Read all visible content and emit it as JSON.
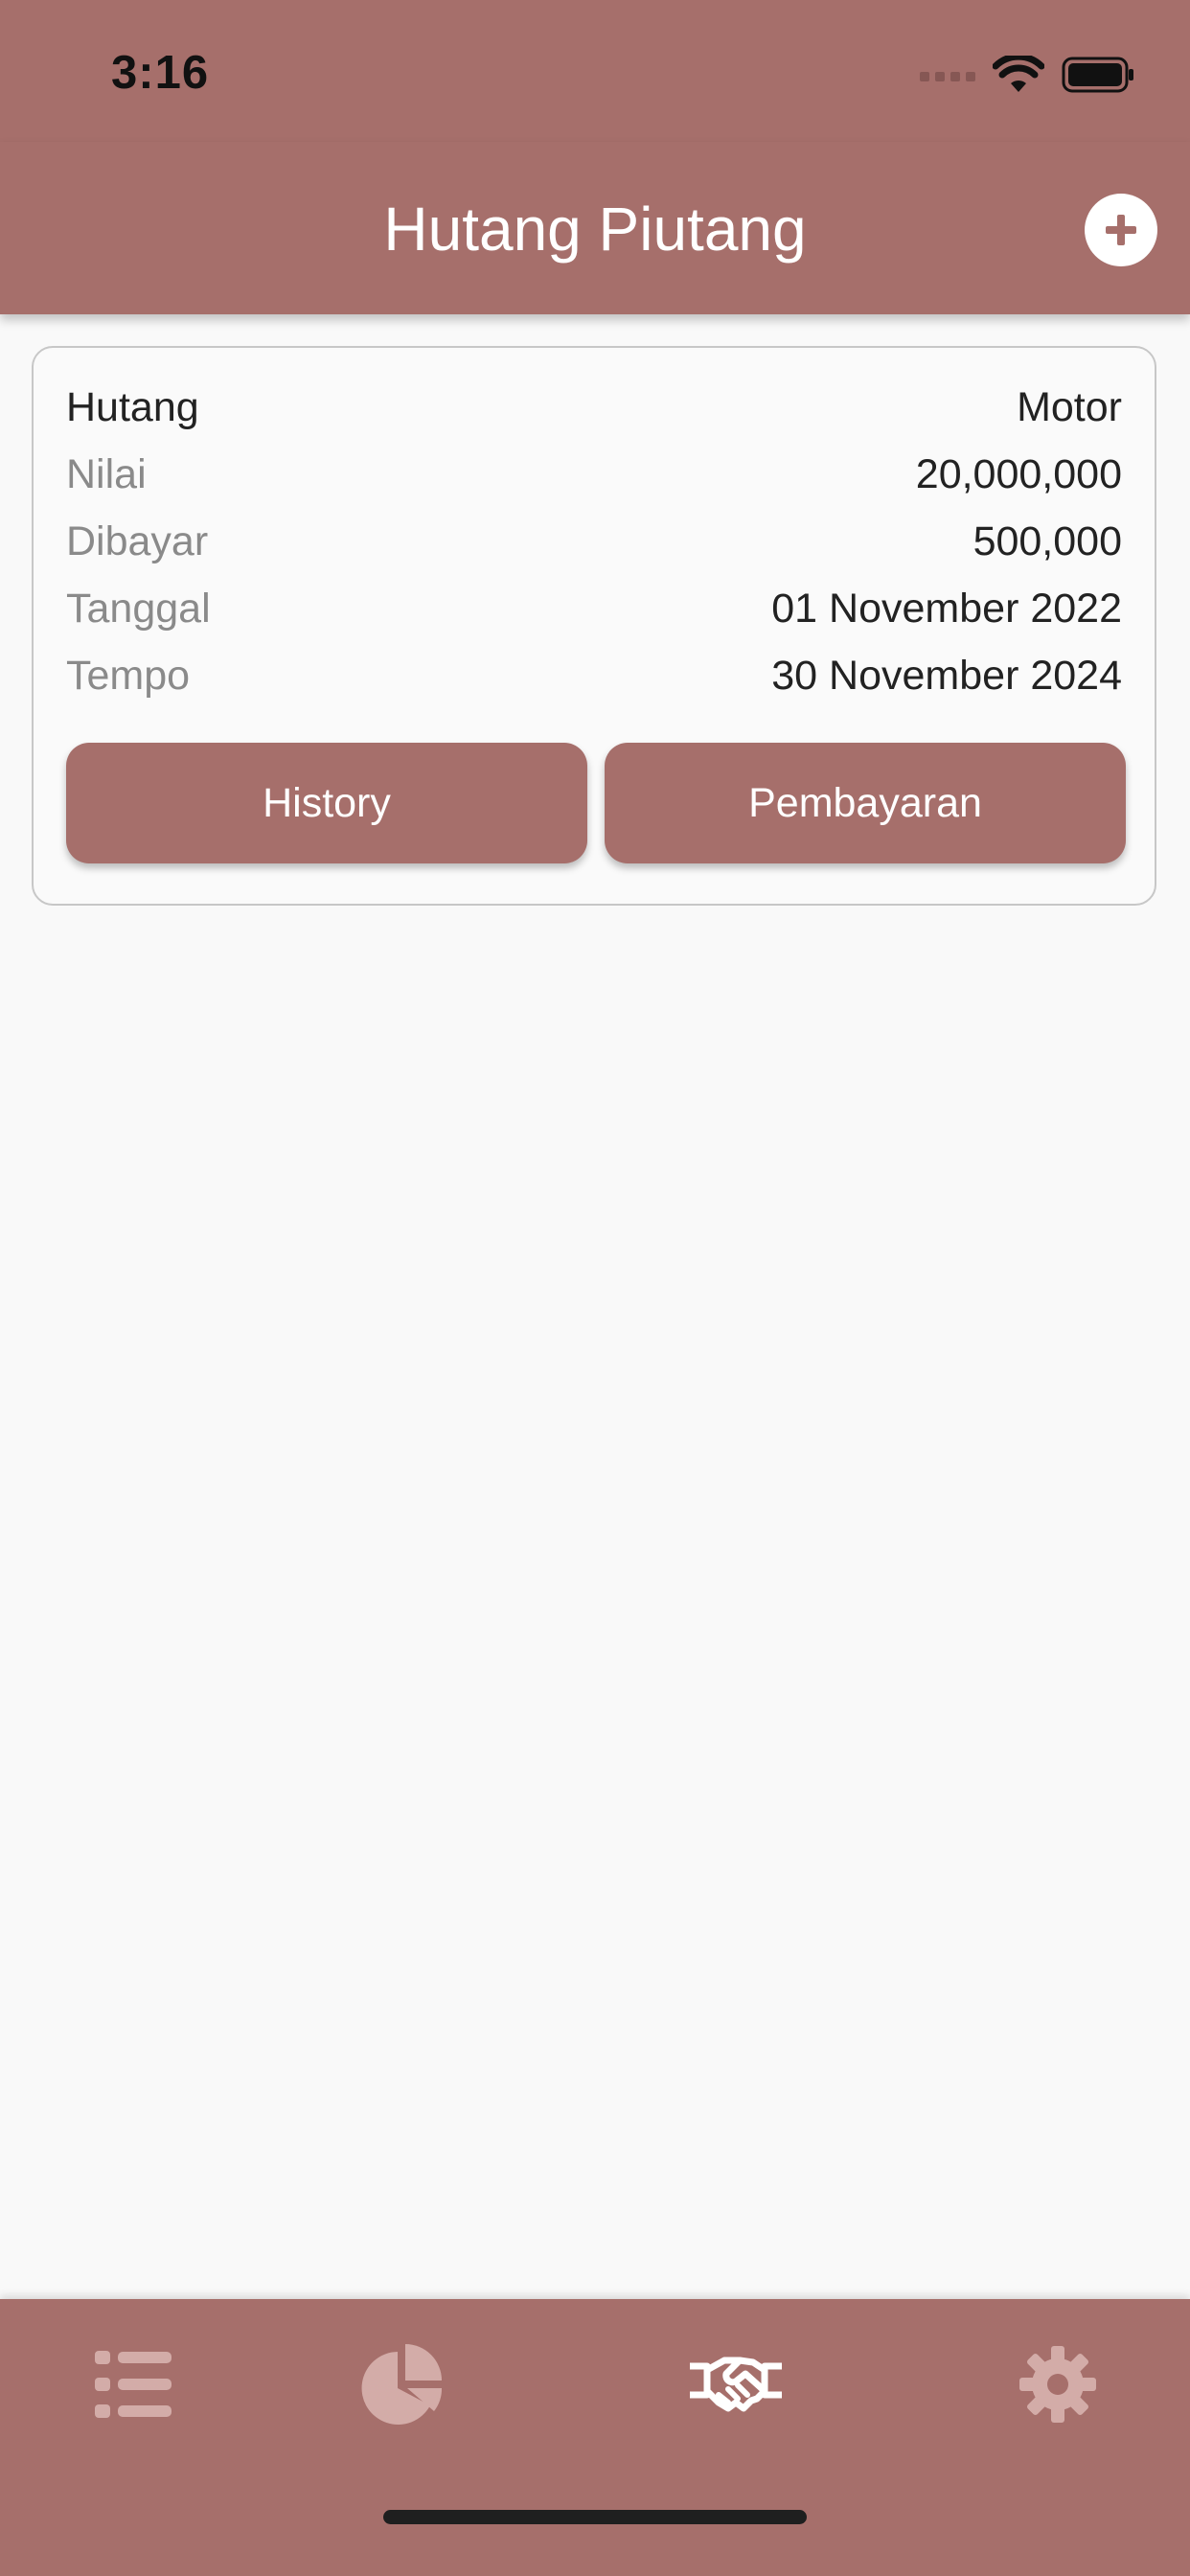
{
  "status_bar": {
    "time": "3:16"
  },
  "header": {
    "title": "Hutang Piutang"
  },
  "card": {
    "type_label": "Hutang",
    "type_value": "Motor",
    "rows": [
      {
        "label": "Nilai",
        "value": "20,000,000"
      },
      {
        "label": "Dibayar",
        "value": "500,000"
      },
      {
        "label": "Tanggal",
        "value": "01 November 2022"
      },
      {
        "label": "Tempo",
        "value": "30 November 2024"
      }
    ],
    "history_button": "History",
    "payment_button": "Pembayaran"
  },
  "nav": {
    "items": [
      {
        "icon": "list-icon",
        "active": false
      },
      {
        "icon": "pie-chart-icon",
        "active": false
      },
      {
        "icon": "handshake-icon",
        "active": true
      },
      {
        "icon": "gear-icon",
        "active": false
      }
    ]
  },
  "colors": {
    "primary": "#a66f6b",
    "background": "#f9f9f9",
    "inactive_icon": "#d3aca8",
    "active_icon": "#ffffff"
  }
}
